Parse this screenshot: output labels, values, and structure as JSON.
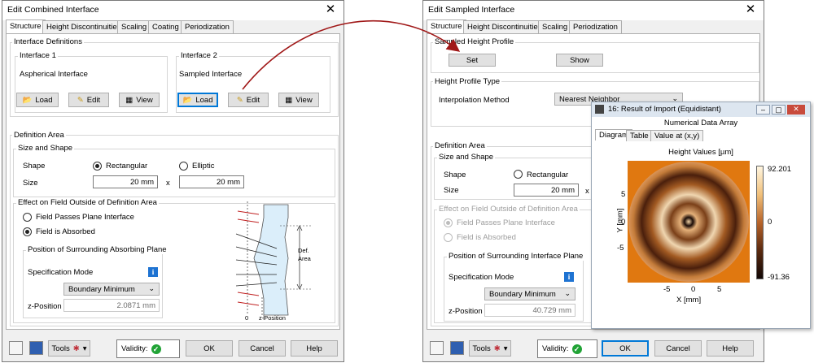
{
  "left": {
    "title": "Edit Combined Interface",
    "tabs": [
      "Structure",
      "Height Discontinuities",
      "Scaling",
      "Coating",
      "Periodization"
    ],
    "interface_definitions": "Interface Definitions",
    "interface1": {
      "label": "Interface 1",
      "name": "Aspherical Interface"
    },
    "interface2": {
      "label": "Interface 2",
      "name": "Sampled Interface"
    },
    "load": "Load",
    "edit": "Edit",
    "view": "View",
    "definition_area": "Definition Area",
    "size_and_shape": "Size and Shape",
    "shape_label": "Shape",
    "rectangular": "Rectangular",
    "elliptic": "Elliptic",
    "size_label": "Size",
    "size_x": "20 mm",
    "size_y": "20 mm",
    "x_sep": "x",
    "effect_group": "Effect on Field Outside of Definition Area",
    "passes": "Field Passes Plane Interface",
    "absorbed": "Field is Absorbed",
    "surround_group": "Position of Surrounding Absorbing Plane",
    "spec_mode_label": "Specification Mode",
    "spec_mode": "Boundary Minimum",
    "zpos_label": "z-Position",
    "zpos": "2.0871 mm",
    "diagram": {
      "def_area": [
        "Def.",
        "Area"
      ],
      "zero": "0",
      "zpos": "z-Position"
    }
  },
  "right": {
    "title": "Edit Sampled Interface",
    "tabs": [
      "Structure",
      "Height Discontinuities",
      "Scaling",
      "Periodization"
    ],
    "sampled_height_profile": "Sampled Height Profile",
    "set": "Set",
    "show": "Show",
    "height_profile_type": "Height Profile Type",
    "interp_label": "Interpolation Method",
    "interp_value": "Nearest Neighbor",
    "definition_area": "Definition Area",
    "size_and_shape": "Size and Shape",
    "shape_label": "Shape",
    "rectangular": "Rectangular",
    "size_label": "Size",
    "size_x": "20 mm",
    "x_sep": "x",
    "effect_group": "Effect on Field Outside of Definition Area",
    "passes": "Field Passes Plane Interface",
    "absorbed": "Field is Absorbed",
    "surround_group": "Position of Surrounding Interface Plane",
    "spec_mode_label": "Specification Mode",
    "spec_mode": "Boundary Minimum",
    "zpos_label": "z-Position",
    "zpos": "40.729 mm"
  },
  "bottom": {
    "tools": "Tools",
    "validity": "Validity:",
    "ok": "OK",
    "cancel": "Cancel",
    "help": "Help"
  },
  "popup": {
    "title": "16: Result of Import (Equidistant)",
    "subtitle": "Numerical Data Array",
    "tabs": [
      "Diagram",
      "Table",
      "Value at (x,y)"
    ],
    "plot_title": "Height Values  [µm]",
    "x_axis_label": "X [mm]",
    "y_axis_label": "Y [mm]",
    "x_ticks": [
      "-5",
      "0",
      "5"
    ],
    "y_ticks": [
      "5",
      "0",
      "-5"
    ],
    "colorbar_ticks": [
      "92.201",
      "0",
      "-91.36"
    ]
  },
  "colors": {
    "arrow": "#a01818",
    "accent": "#0078d7",
    "plot_bg": "#e07810",
    "valid": "#21a336"
  }
}
